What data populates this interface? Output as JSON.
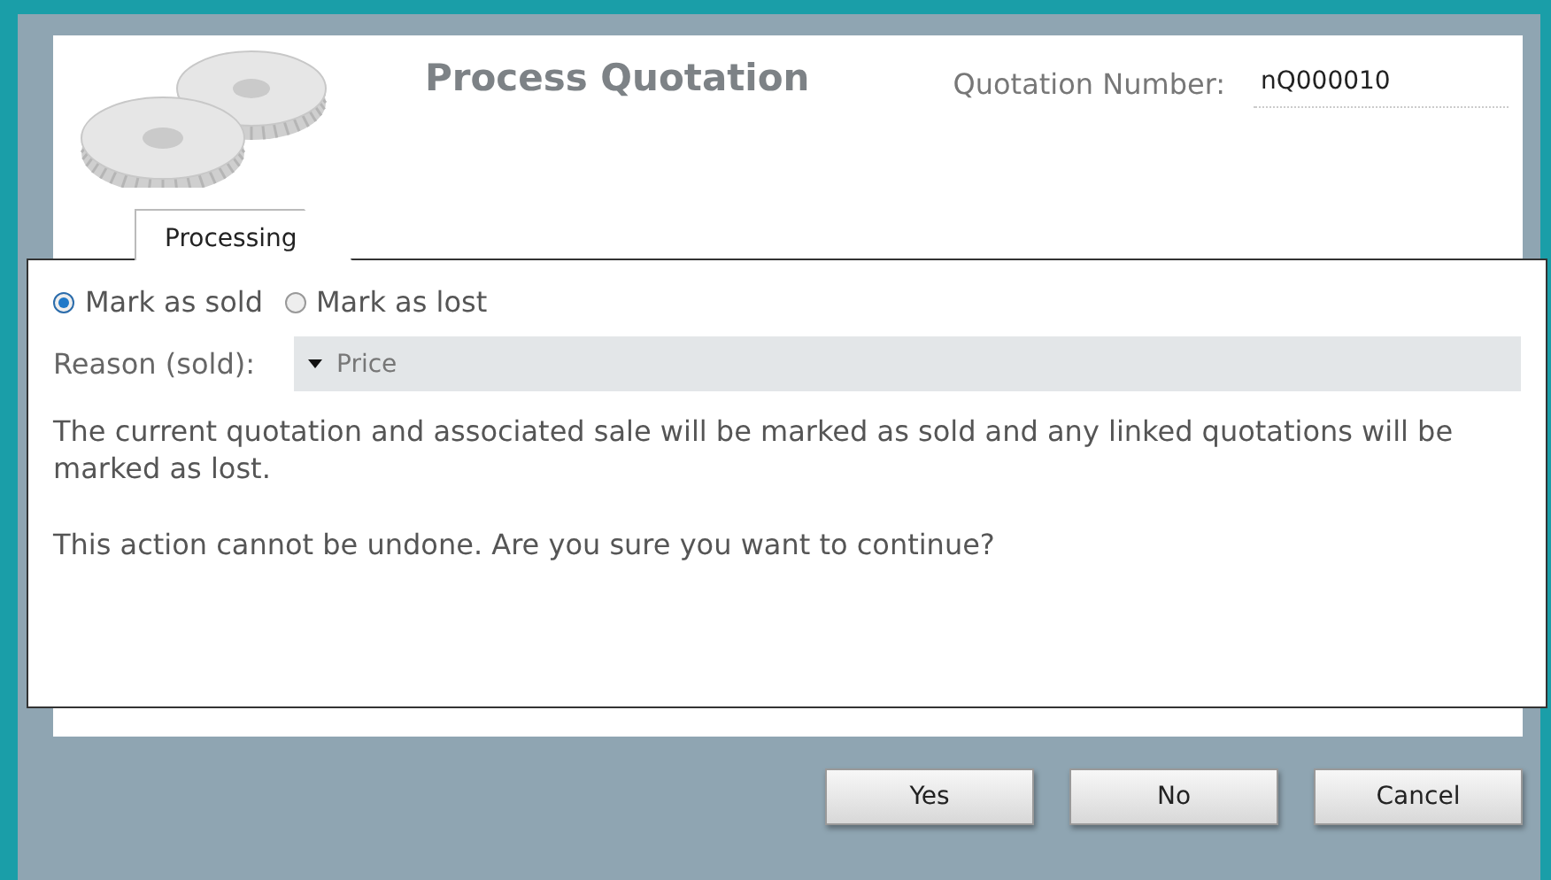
{
  "header": {
    "title": "Process Quotation",
    "number_label": "Quotation Number:",
    "number_value": "nQ000010"
  },
  "tabs": [
    {
      "label": "Processing",
      "selected": true
    }
  ],
  "options": [
    {
      "label": "Mark as sold",
      "selected": true
    },
    {
      "label": "Mark as lost",
      "selected": false
    }
  ],
  "reason": {
    "label": "Reason (sold):",
    "value": "Price"
  },
  "messages": [
    "The current quotation and associated sale will be marked as sold and any linked quotations will be marked as lost.",
    "This action cannot be undone. Are you sure you want to continue?"
  ],
  "buttons": [
    "Yes",
    "No",
    "Cancel"
  ]
}
